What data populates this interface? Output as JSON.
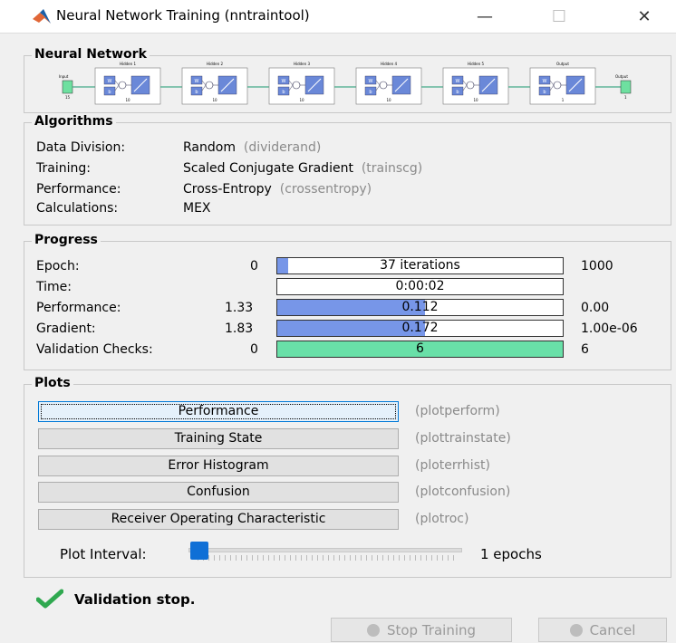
{
  "window": {
    "title": "Neural Network Training (nntraintool)",
    "minimize": "—",
    "maximize": "☐",
    "close": "✕"
  },
  "network": {
    "legend": "Neural Network",
    "input_label": "Input",
    "input_size": "15",
    "output_label": "Output",
    "output_size": "1",
    "layers": [
      {
        "name": "Hidden 1",
        "size": "10"
      },
      {
        "name": "Hidden 2",
        "size": "10"
      },
      {
        "name": "Hidden 3",
        "size": "10"
      },
      {
        "name": "Hidden 4",
        "size": "10"
      },
      {
        "name": "Hidden 5",
        "size": "10"
      },
      {
        "name": "Output",
        "size": "1"
      }
    ],
    "w_label": "W",
    "b_label": "b"
  },
  "algorithms": {
    "legend": "Algorithms",
    "rows": [
      {
        "label": "Data Division:",
        "value": "Random",
        "func": "(dividerand)"
      },
      {
        "label": "Training:",
        "value": "Scaled Conjugate Gradient",
        "func": "(trainscg)"
      },
      {
        "label": "Performance:",
        "value": "Cross-Entropy",
        "func": "(crossentropy)"
      },
      {
        "label": "Calculations:",
        "value": "MEX",
        "func": ""
      }
    ]
  },
  "progress": {
    "legend": "Progress",
    "rows": [
      {
        "label": "Epoch:",
        "min": "0",
        "value": "37 iterations",
        "max": "1000",
        "fill": 0.037
      },
      {
        "label": "Time:",
        "min": "",
        "value": "0:00:02",
        "max": "",
        "fill": 0
      },
      {
        "label": "Performance:",
        "min": "1.33",
        "value": "0.112",
        "max": "0.00",
        "fill": 0.516
      },
      {
        "label": "Gradient:",
        "min": "1.83",
        "value": "0.172",
        "max": "1.00e-06",
        "fill": 0.516
      },
      {
        "label": "Validation Checks:",
        "min": "0",
        "value": "6",
        "max": "6",
        "fill": 1.0
      }
    ],
    "colors": {
      "bar": "#7796e8",
      "validation": "#69e0a8"
    }
  },
  "plots": {
    "legend": "Plots",
    "buttons": [
      {
        "label": "Performance",
        "func": "(plotperform)"
      },
      {
        "label": "Training State",
        "func": "(plottrainstate)"
      },
      {
        "label": "Error Histogram",
        "func": "(ploterrhist)"
      },
      {
        "label": "Confusion",
        "func": "(plotconfusion)"
      },
      {
        "label": "Receiver Operating Characteristic",
        "func": "(plotroc)"
      }
    ],
    "interval_label": "Plot Interval:",
    "interval_value": "1 epochs"
  },
  "status": {
    "icon": "checkmark-icon",
    "text": "Validation stop.",
    "color": "#2fa84f"
  },
  "footer": {
    "stop_label": "Stop Training",
    "cancel_label": "Cancel"
  }
}
